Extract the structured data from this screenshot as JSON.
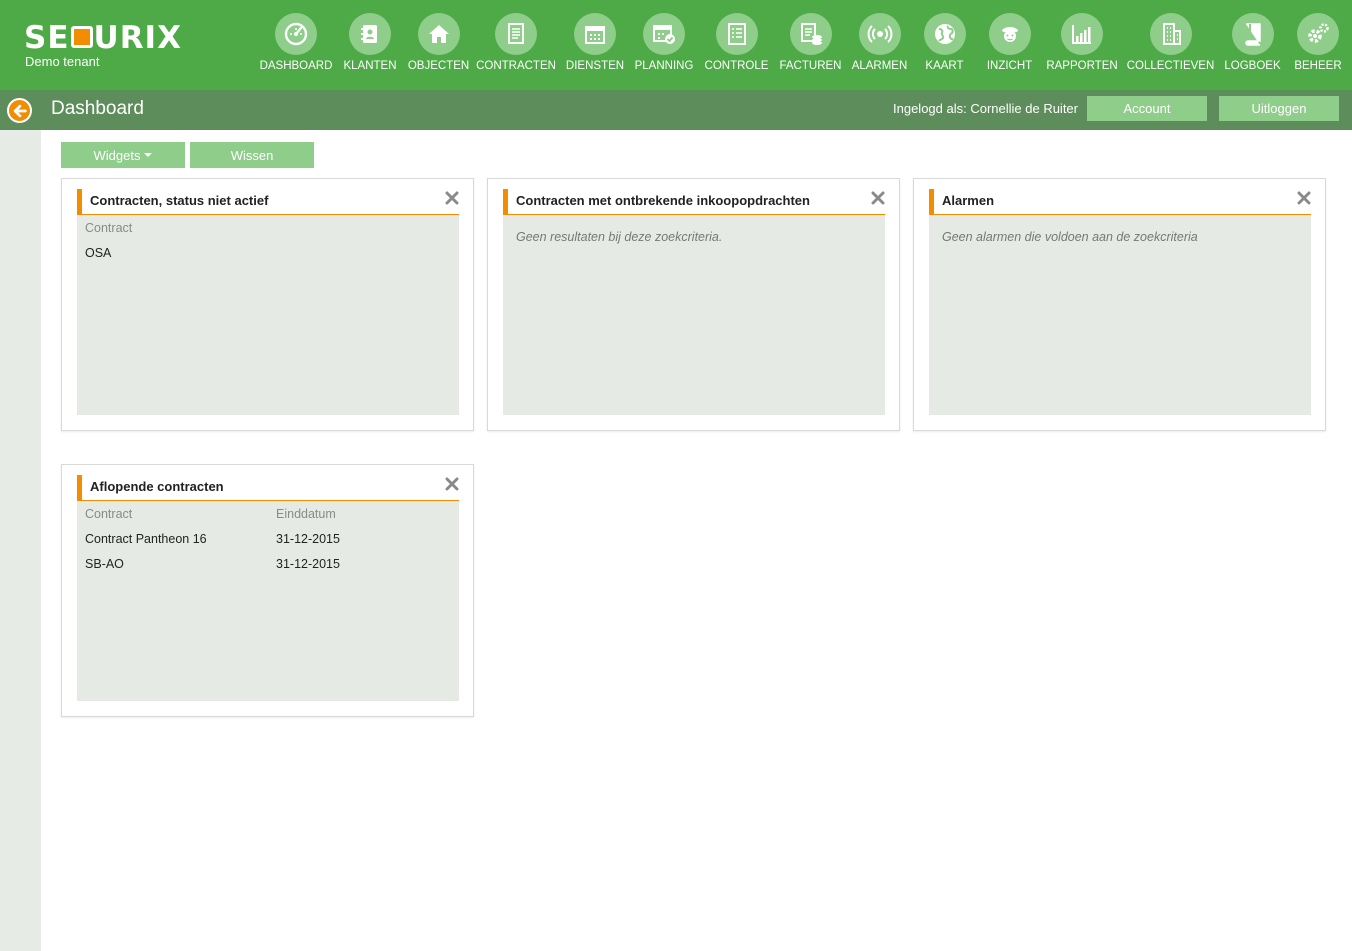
{
  "brand": {
    "logo_text_1": "SE",
    "logo_text_2": "URIX",
    "tenant": "Demo tenant",
    "colors": {
      "primary": "#4eaa47",
      "accent": "#f28c00",
      "icon_bg": "#8fcd8a",
      "subbar": "#5c8d5a"
    }
  },
  "nav": [
    {
      "label": "DASHBOARD",
      "icon": "dashboard-gauge-icon"
    },
    {
      "label": "KLANTEN",
      "icon": "address-book-icon"
    },
    {
      "label": "OBJECTEN",
      "icon": "home-icon"
    },
    {
      "label": "CONTRACTEN",
      "icon": "document-icon"
    },
    {
      "label": "DIENSTEN",
      "icon": "calendar-icon"
    },
    {
      "label": "PLANNING",
      "icon": "calendar-check-icon"
    },
    {
      "label": "CONTROLE",
      "icon": "checklist-icon"
    },
    {
      "label": "FACTUREN",
      "icon": "invoice-coins-icon"
    },
    {
      "label": "ALARMEN",
      "icon": "alarm-signal-icon"
    },
    {
      "label": "KAART",
      "icon": "globe-icon"
    },
    {
      "label": "INZICHT",
      "icon": "guard-icon"
    },
    {
      "label": "RAPPORTEN",
      "icon": "bar-chart-icon"
    },
    {
      "label": "COLLECTIEVEN",
      "icon": "building-icon"
    },
    {
      "label": "LOGBOEK",
      "icon": "book-icon"
    },
    {
      "label": "BEHEER",
      "icon": "gears-icon"
    }
  ],
  "header": {
    "title": "Dashboard",
    "user_label": "Ingelogd als: Cornellie de Ruiter",
    "account_label": "Account",
    "logout_label": "Uitloggen"
  },
  "toolbar": {
    "widgets_label": "Widgets",
    "clear_label": "Wissen"
  },
  "widgets": {
    "inactive": {
      "title": "Contracten, status niet actief",
      "col_contract": "Contract",
      "rows": [
        {
          "contract": "OSA"
        }
      ]
    },
    "missing": {
      "title": "Contracten met ontbrekende inkoopopdrachten",
      "empty": "Geen resultaten bij deze zoekcriteria."
    },
    "alarms": {
      "title": "Alarmen",
      "empty": "Geen alarmen die voldoen aan de zoekcriteria"
    },
    "expiring": {
      "title": "Aflopende contracten",
      "col_contract": "Contract",
      "col_end": "Einddatum",
      "rows": [
        {
          "contract": "Contract Pantheon 16",
          "end": "31-12-2015"
        },
        {
          "contract": "SB-AO",
          "end": "31-12-2015"
        }
      ]
    }
  }
}
